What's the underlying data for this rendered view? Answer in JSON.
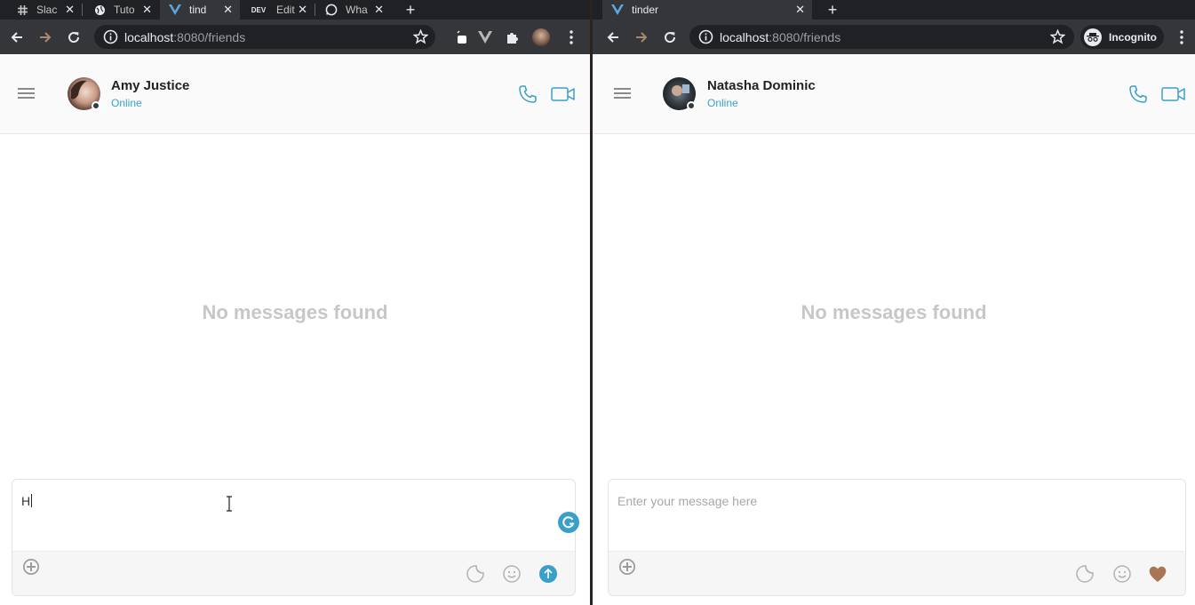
{
  "left_window": {
    "tabs": [
      {
        "label": "Slac",
        "icon": "slack-icon"
      },
      {
        "label": "Tuto",
        "icon": "globe-icon"
      },
      {
        "label": "tind",
        "icon": "vue-icon"
      },
      {
        "label": "Edit",
        "icon": "dev-icon",
        "icon_text": "DEV"
      },
      {
        "label": "Wha",
        "icon": "whatsapp-icon"
      }
    ],
    "url_host": "localhost",
    "url_path": ":8080/friends",
    "contact": {
      "name": "Amy Justice",
      "status": "Online"
    },
    "empty_text": "No messages found",
    "composer_value": "H"
  },
  "right_window": {
    "tabs": [
      {
        "label": "tinder",
        "icon": "vue-icon"
      }
    ],
    "url_host": "localhost",
    "url_path": ":8080/friends",
    "incognito_label": "Incognito",
    "contact": {
      "name": "Natasha Dominic",
      "status": "Online"
    },
    "empty_text": "No messages found",
    "composer_placeholder": "Enter your message here"
  },
  "colors": {
    "accent": "#3aa0c9",
    "heart": "#a87556",
    "empty_text": "#c7c7c7"
  }
}
